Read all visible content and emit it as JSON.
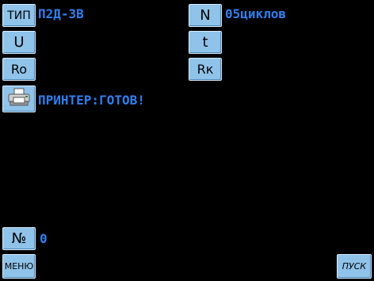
{
  "colors": {
    "background": "#000000",
    "button_face": "#8fc3ea",
    "value_text": "#2f7ff0"
  },
  "buttons": {
    "type": "ТИП",
    "n": "N",
    "u": "U",
    "t": "t",
    "ro": "Ro",
    "rk": "Rк",
    "printer_icon": "printer-icon",
    "number": "№",
    "menu": "МЕНЮ",
    "start": "ПУСК"
  },
  "values": {
    "type": "П2Д-3В",
    "n": "05циклов",
    "printer_status": "ПРИНТЕР:ГОТОВ!",
    "number": "0"
  }
}
